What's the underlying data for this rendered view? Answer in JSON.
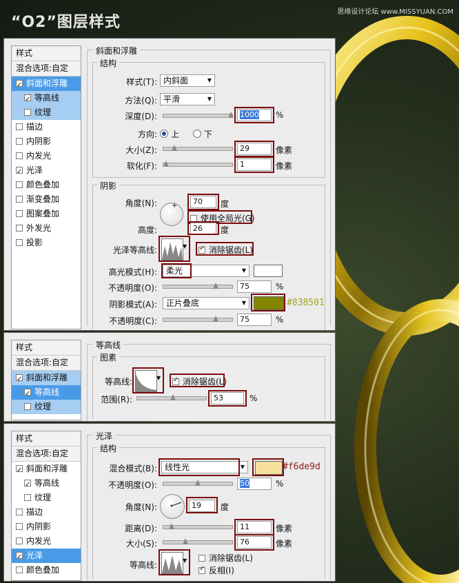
{
  "page": {
    "title": "“O2”图层样式",
    "watermark": "思缘设计论坛 www.MISSYUAN.COM"
  },
  "panel1": {
    "sidebar": [
      {
        "label": "样式",
        "type": "hdr"
      },
      {
        "label": "混合选项:自定",
        "type": "hdr"
      },
      {
        "label": "斜面和浮雕",
        "checked": true,
        "type": "sel"
      },
      {
        "label": "等高线",
        "checked": true,
        "type": "light",
        "sub": true
      },
      {
        "label": "纹理",
        "checked": false,
        "type": "light",
        "sub": true
      },
      {
        "label": "描边",
        "checked": false
      },
      {
        "label": "内阴影",
        "checked": false
      },
      {
        "label": "内发光",
        "checked": false
      },
      {
        "label": "光泽",
        "checked": true
      },
      {
        "label": "颜色叠加",
        "checked": false
      },
      {
        "label": "渐变叠加",
        "checked": false
      },
      {
        "label": "图案叠加",
        "checked": false
      },
      {
        "label": "外发光",
        "checked": false
      },
      {
        "label": "投影",
        "checked": false
      }
    ],
    "section_title": "斜面和浮雕",
    "structure_title": "结构",
    "style_label": "样式(T):",
    "style_value": "内斜面",
    "technique_label": "方法(Q):",
    "technique_value": "平滑",
    "depth_label": "深度(D):",
    "depth_value": "1000",
    "depth_unit": "%",
    "direction_label": "方向:",
    "direction_up": "上",
    "direction_down": "下",
    "size_label": "大小(Z):",
    "size_value": "29",
    "size_unit": "像素",
    "soften_label": "软化(F):",
    "soften_value": "1",
    "soften_unit": "像素",
    "shading_title": "阴影",
    "angle_label": "角度(N):",
    "angle_value": "70",
    "angle_unit": "度",
    "global_light_label": "使用全局光(G)",
    "global_light_checked": false,
    "altitude_label": "高度:",
    "altitude_value": "26",
    "altitude_unit": "度",
    "gloss_contour_label": "光泽等高线:",
    "antialias_label": "消除锯齿(L)",
    "antialias_checked": true,
    "highlight_mode_label": "高光模式(H):",
    "highlight_mode_value": "柔光",
    "highlight_color": "#ffffff",
    "highlight_opacity_label": "不透明度(O):",
    "highlight_opacity_value": "75",
    "opacity_unit": "%",
    "shadow_mode_label": "阴影模式(A):",
    "shadow_mode_value": "正片叠底",
    "shadow_color": "#838501",
    "shadow_color_text": "#838501",
    "shadow_opacity_label": "不透明度(C):",
    "shadow_opacity_value": "75"
  },
  "panel2": {
    "sidebar": [
      {
        "label": "样式",
        "type": "hdr"
      },
      {
        "label": "混合选项:自定",
        "type": "hdr"
      },
      {
        "label": "斜面和浮雕",
        "checked": true,
        "type": "light"
      },
      {
        "label": "等高线",
        "checked": true,
        "type": "sel",
        "sub": true
      },
      {
        "label": "纹理",
        "checked": false,
        "type": "light",
        "sub": true
      }
    ],
    "section_title": "等高线",
    "elements_title": "图素",
    "contour_label": "等高线:",
    "antialias_label": "消除锯齿(L)",
    "antialias_checked": true,
    "range_label": "范围(R):",
    "range_value": "53",
    "range_unit": "%"
  },
  "panel3": {
    "sidebar": [
      {
        "label": "样式",
        "type": "hdr"
      },
      {
        "label": "混合选项:自定",
        "type": "hdr"
      },
      {
        "label": "斜面和浮雕",
        "checked": true
      },
      {
        "label": "等高线",
        "checked": true,
        "sub": true
      },
      {
        "label": "纹理",
        "checked": false,
        "sub": true
      },
      {
        "label": "描边",
        "checked": false
      },
      {
        "label": "内阴影",
        "checked": false
      },
      {
        "label": "内发光",
        "checked": false
      },
      {
        "label": "光泽",
        "checked": true,
        "type": "sel"
      },
      {
        "label": "颜色叠加",
        "checked": false
      }
    ],
    "section_title": "光泽",
    "structure_title": "结构",
    "blend_mode_label": "混合模式(B):",
    "blend_mode_value": "线性光",
    "blend_color": "#f6de9d",
    "blend_color_text": "#f6de9d",
    "opacity_label": "不透明度(O):",
    "opacity_value": "50",
    "opacity_unit": "%",
    "angle_label": "角度(N):",
    "angle_value": "19",
    "angle_unit": "度",
    "distance_label": "距离(D):",
    "distance_value": "11",
    "distance_unit": "像素",
    "size_label": "大小(S):",
    "size_value": "76",
    "size_unit": "像素",
    "contour_label": "等高线:",
    "antialias_label": "消除锯齿(L)",
    "antialias_checked": false,
    "invert_label": "反相(I)",
    "invert_checked": true
  }
}
